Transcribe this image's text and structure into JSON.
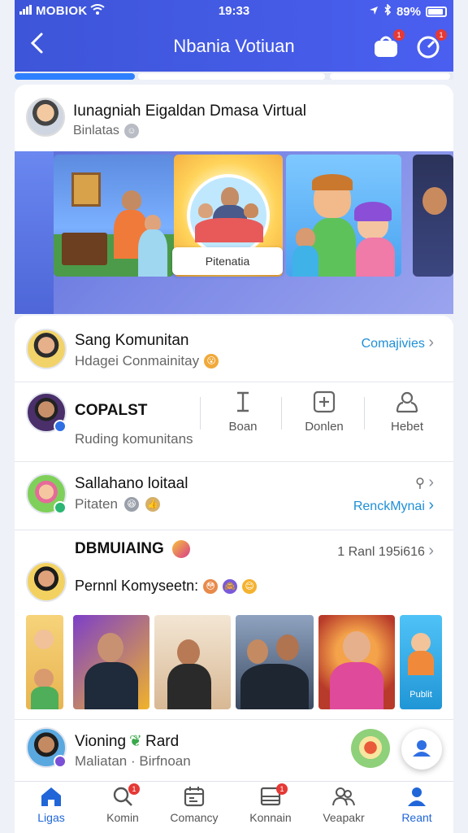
{
  "status_bar": {
    "carrier": "MOBIOK",
    "time": "19:33",
    "battery": "89%"
  },
  "header": {
    "title": "Nbania Votiuan",
    "notification_badge": "1",
    "alerts_badge": "1"
  },
  "featured": {
    "title": "Iunagniah Eigaldan Dmasa Virtual",
    "subtitle": "Binlatas",
    "chip_label": "Pitenatia"
  },
  "rows": {
    "community": {
      "title": "Sang Komunitan",
      "subtitle": "Hdagei Conmainitay",
      "link": "Comajivies"
    },
    "room": {
      "title": "COPALST",
      "subtitle": "Ruding komunitans",
      "action_1": "Boan",
      "action_2": "Donlen",
      "action_3": "Hebet"
    },
    "greeting": {
      "title": "Sallahano loitaal",
      "subtitle": "Pitaten",
      "link": "RenckMynai"
    },
    "section": {
      "heading": "DBMUIAING",
      "meta": "1 Ranl 195i616"
    },
    "personal": {
      "title": "Pernnl Komyseetn:"
    },
    "gallery": {
      "last_label": "Publit"
    },
    "viewing": {
      "title": "Vioning",
      "title_2": "Rard",
      "subtitle": "Maliatan · Birfnoan"
    }
  },
  "bottom_nav": [
    {
      "label": "Ligas",
      "icon": "home-icon",
      "active": true
    },
    {
      "label": "Komin",
      "icon": "search-icon",
      "badge": "1"
    },
    {
      "label": "Comancy",
      "icon": "calendar-icon"
    },
    {
      "label": "Konnain",
      "icon": "inbox-icon",
      "badge": "1"
    },
    {
      "label": "Veapakr",
      "icon": "people-icon"
    },
    {
      "label": "Reant",
      "icon": "profile-icon"
    }
  ],
  "colors": {
    "header_blue": "#4357e6",
    "accent_link": "#1f8fd6",
    "active_nav": "#2066d8",
    "badge_red": "#e53935"
  }
}
